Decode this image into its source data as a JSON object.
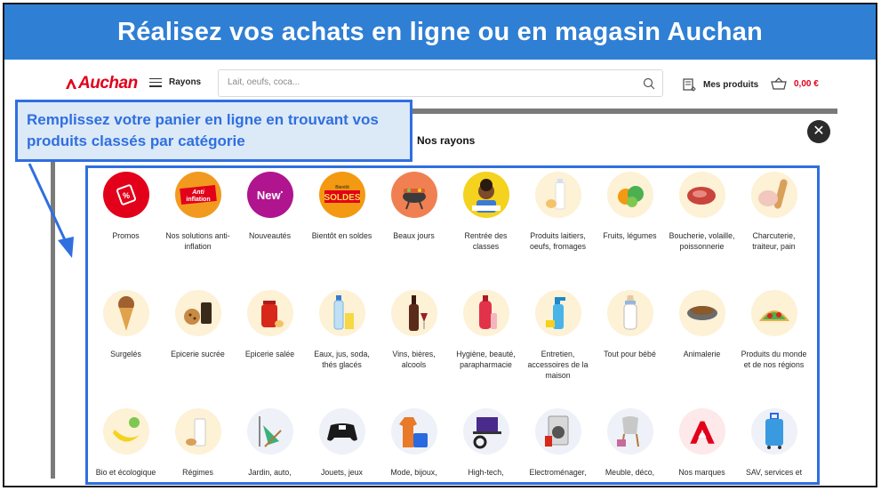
{
  "banner": {
    "title": "Réalisez vos achats en ligne ou en magasin Auchan"
  },
  "header": {
    "logo": "Auchan",
    "menu_label": "Rayons",
    "search_placeholder": "Lait, oeufs, coca...",
    "my_products_label": "Mes produits",
    "cart_total": "0,00 €"
  },
  "panel": {
    "title": "Nos rayons",
    "close_symbol": "✕"
  },
  "callout": {
    "text": "Remplissez votre panier en ligne en trouvant vos produits classés par catégorie"
  },
  "categories": [
    {
      "label": "Promos",
      "icon": "percent-tag-icon",
      "bg": "#e2001a"
    },
    {
      "label": "Nos solutions anti-inflation",
      "icon": "anti-inflation-icon",
      "bg": "#f29a1f"
    },
    {
      "label": "Nouveautés",
      "icon": "new-badge-icon",
      "bg": "#b0148f"
    },
    {
      "label": "Bientôt en soldes",
      "icon": "soldes-icon",
      "bg": "#f39a12"
    },
    {
      "label": "Beaux jours",
      "icon": "barbecue-icon",
      "bg": "#f08052"
    },
    {
      "label": "Rentrée des classes",
      "icon": "school-child-icon",
      "bg": "#f4d21e"
    },
    {
      "label": "Produits laitiers, oeufs, fromages",
      "icon": "milk-icon",
      "bg": "#fdf1d6"
    },
    {
      "label": "Fruits, légumes",
      "icon": "fruits-icon",
      "bg": "#fdf1d6"
    },
    {
      "label": "Boucherie, volaille, poissonnerie",
      "icon": "meat-icon",
      "bg": "#fdf1d6"
    },
    {
      "label": "Charcuterie, traiteur, pain",
      "icon": "charcuterie-icon",
      "bg": "#fdf1d6"
    },
    {
      "label": "Surgelés",
      "icon": "ice-cream-icon",
      "bg": "#fdf1d6"
    },
    {
      "label": "Epicerie sucrée",
      "icon": "cookies-icon",
      "bg": "#fdf1d6"
    },
    {
      "label": "Epicerie salée",
      "icon": "jar-icon",
      "bg": "#fdf1d6"
    },
    {
      "label": "Eaux, jus, soda, thés glacés",
      "icon": "water-bottle-icon",
      "bg": "#fdf1d6"
    },
    {
      "label": "Vins, bières, alcools",
      "icon": "wine-icon",
      "bg": "#fdf1d6"
    },
    {
      "label": "Hygiène, beauté, parapharmacie",
      "icon": "shampoo-icon",
      "bg": "#fdf1d6"
    },
    {
      "label": "Entretien, accessoires de la maison",
      "icon": "spray-icon",
      "bg": "#fdf1d6"
    },
    {
      "label": "Tout pour bébé",
      "icon": "baby-bottle-icon",
      "bg": "#fdf1d6"
    },
    {
      "label": "Animalerie",
      "icon": "pet-bowl-icon",
      "bg": "#fdf1d6"
    },
    {
      "label": "Produits du monde et de nos régions",
      "icon": "taco-icon",
      "bg": "#fdf1d6"
    },
    {
      "label": "Bio et écologique",
      "icon": "banana-icon",
      "bg": "#fdf1d6"
    },
    {
      "label": "Régimes",
      "icon": "diet-glass-icon",
      "bg": "#fdf1d6"
    },
    {
      "label": "Jardin, auto,",
      "icon": "deck-chair-icon",
      "bg": "#eef1f8"
    },
    {
      "label": "Jouets, jeux",
      "icon": "gamepad-icon",
      "bg": "#eef1f8"
    },
    {
      "label": "Mode, bijoux,",
      "icon": "clothes-icon",
      "bg": "#eef1f8"
    },
    {
      "label": "High-tech,",
      "icon": "laptop-icon",
      "bg": "#eef1f8"
    },
    {
      "label": "Electroménager,",
      "icon": "washing-machine-icon",
      "bg": "#eef1f8"
    },
    {
      "label": "Meuble, déco,",
      "icon": "chair-icon",
      "bg": "#eef1f8"
    },
    {
      "label": "Nos marques",
      "icon": "auchan-bird-icon",
      "bg": "#fde8ea"
    },
    {
      "label": "SAV, services et",
      "icon": "suitcase-icon",
      "bg": "#eef1f8"
    }
  ],
  "colors": {
    "brand_red": "#e2001a",
    "banner_blue": "#2f7fd4",
    "highlight_blue": "#2f6fe0"
  }
}
